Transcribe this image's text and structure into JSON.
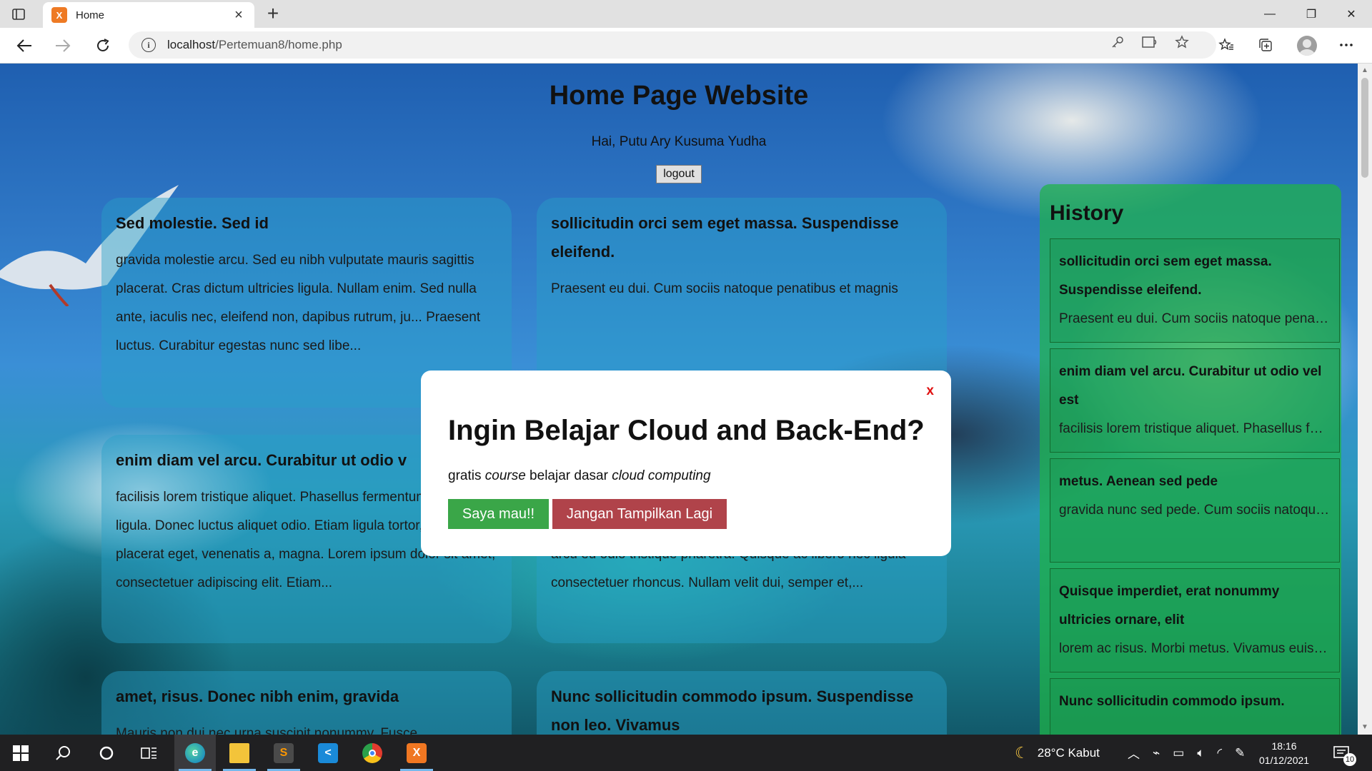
{
  "browser": {
    "tab_title": "Home",
    "tab_favicon_text": "X",
    "new_tab_label": "+",
    "url_host": "localhost",
    "url_path": "/Pertemuan8/home.php",
    "window_controls": {
      "minimize": "—",
      "maximize": "❐",
      "close": "✕"
    }
  },
  "page": {
    "title": "Home Page Website",
    "greeting": "Hai, Putu Ary Kusuma Yudha",
    "logout_label": "logout"
  },
  "cards": [
    {
      "title": "Sed molestie. Sed id",
      "body": "gravida molestie arcu. Sed eu nibh vulputate mauris sagittis placerat. Cras dictum ultricies ligula. Nullam enim. Sed nulla ante, iaculis nec, eleifend non, dapibus rutrum, ju... Praesent luctus. Curabitur egestas nunc sed libe..."
    },
    {
      "title": "sollicitudin orci sem eget massa. Suspendisse eleifend.",
      "body": "Praesent eu dui. Cum sociis natoque penatibus et magnis"
    },
    {
      "title": "enim diam vel arcu. Curabitur ut odio v",
      "body": "facilisis lorem tristique aliquet. Phasellus fermentum convallis ligula. Donec luctus aliquet odio. Etiam ligula tortor, dictum eu, placerat eget, venenatis a, magna. Lorem ipsum dolor sit amet, consectetuer adipiscing elit. Etiam..."
    },
    {
      "title": "",
      "body": "gravida nunc sed pede. Cum sociis natoque penatibus et magnis dis parturient montes, nascetur ridiculus mus. Proin vel arcu eu odio tristique pharetra. Quisque ac libero nec ligula consectetuer rhoncus. Nullam velit dui, semper et,..."
    },
    {
      "title": "amet, risus. Donec nibh enim, gravida",
      "body": "Mauris non dui nec urna suscipit nonummy. Fusce"
    },
    {
      "title": "Nunc sollicitudin commodo ipsum. Suspendisse non leo. Vivamus",
      "body": ""
    }
  ],
  "history": {
    "heading": "History",
    "items": [
      {
        "title": "sollicitudin orci sem eget massa. Suspendisse eleifend.",
        "snippet": "Praesent eu dui. Cum sociis natoque penatibus et magnis"
      },
      {
        "title": "enim diam vel arcu. Curabitur ut odio vel est",
        "snippet": "facilisis lorem tristique aliquet. Phasellus fermentum"
      },
      {
        "title": "metus. Aenean sed pede",
        "snippet": "gravida nunc sed pede. Cum sociis natoque penatibus et magnis dis parturient"
      },
      {
        "title": "Quisque imperdiet, erat nonummy ultricies ornare, elit",
        "snippet": "lorem ac risus. Morbi metus. Vivamus euismod"
      },
      {
        "title": "Nunc sollicitudin commodo ipsum.",
        "snippet": ""
      }
    ]
  },
  "modal": {
    "close_label": "x",
    "heading": "Ingin Belajar Cloud and Back-End?",
    "desc_1": "gratis ",
    "desc_2": "course",
    "desc_3": " belajar dasar ",
    "desc_4": "cloud computing",
    "yes_label": "Saya mau!!",
    "no_label": "Jangan Tampilkan Lagi"
  },
  "taskbar": {
    "weather": "28°C  Kabut",
    "time": "18:16",
    "date": "01/12/2021",
    "notification_count": "10"
  },
  "colors": {
    "modal_yes": "#3aa648",
    "modal_no": "#b0434a",
    "modal_close": "#e01010",
    "history_panel": "#1eb446"
  }
}
